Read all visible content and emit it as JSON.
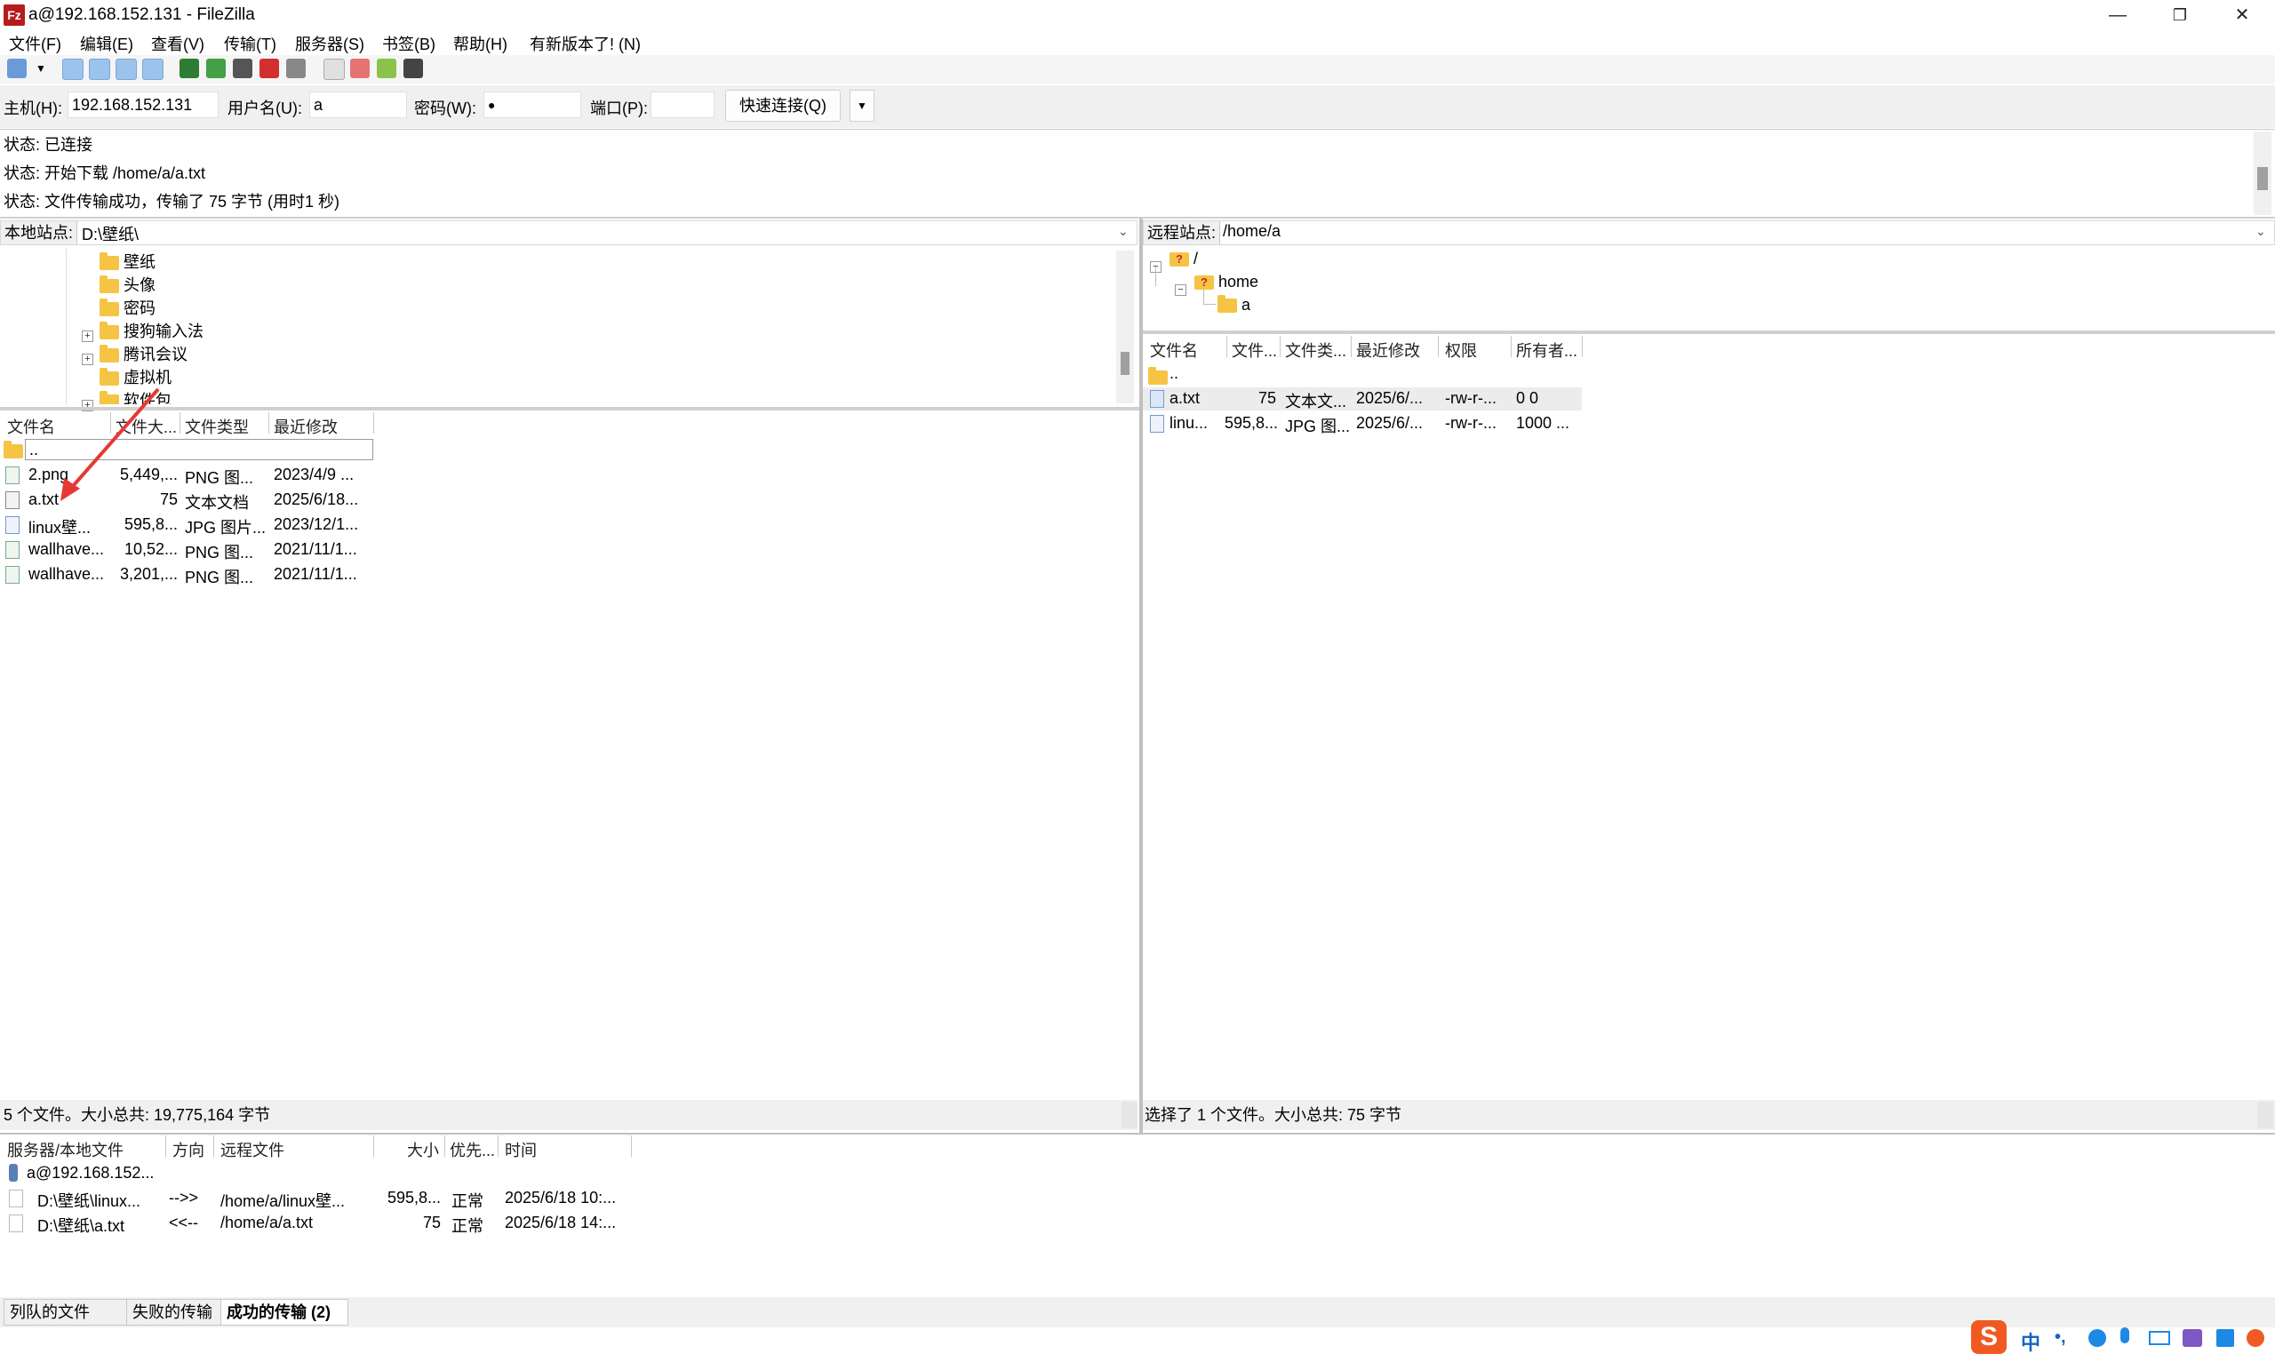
{
  "window": {
    "title": "a@192.168.152.131 - FileZilla",
    "app_icon": "Fz"
  },
  "menu": [
    "文件(F)",
    "编辑(E)",
    "查看(V)",
    "传输(T)",
    "服务器(S)",
    "书签(B)",
    "帮助(H)",
    "有新版本了! (N)"
  ],
  "quickconnect": {
    "host_label": "主机(H):",
    "host_value": "192.168.152.131",
    "user_label": "用户名(U):",
    "user_value": "a",
    "pass_label": "密码(W):",
    "pass_value": "●",
    "port_label": "端口(P):",
    "port_value": "",
    "button": "快速连接(Q)"
  },
  "log": [
    "状态: 已连接",
    "状态: 开始下载 /home/a/a.txt",
    "状态: 文件传输成功，传输了 75 字节 (用时1 秒)"
  ],
  "local": {
    "site_label": "本地站点:",
    "path": "D:\\壁纸\\",
    "tree": [
      "壁纸",
      "头像",
      "密码",
      "搜狗输入法",
      "腾讯会议",
      "虚拟机",
      "软件包"
    ],
    "headers": [
      "文件名",
      "文件大...",
      "文件类型",
      "最近修改"
    ],
    "parent": "..",
    "rows": [
      {
        "name": "2.png",
        "size": "5,449,...",
        "type": "PNG 图...",
        "modified": "2023/4/9 ..."
      },
      {
        "name": "a.txt",
        "size": "75",
        "type": "文本文档",
        "modified": "2025/6/18..."
      },
      {
        "name": "linux壁...",
        "size": "595,8...",
        "type": "JPG 图片...",
        "modified": "2023/12/1..."
      },
      {
        "name": "wallhave...",
        "size": "10,52...",
        "type": "PNG 图...",
        "modified": "2021/11/1..."
      },
      {
        "name": "wallhave...",
        "size": "3,201,...",
        "type": "PNG 图...",
        "modified": "2021/11/1..."
      }
    ],
    "status": "5 个文件。大小总共: 19,775,164 字节"
  },
  "remote": {
    "site_label": "远程站点:",
    "path": "/home/a",
    "tree": [
      "/",
      "home",
      "a"
    ],
    "headers": [
      "文件名",
      "文件...",
      "文件类...",
      "最近修改",
      "权限",
      "所有者..."
    ],
    "parent": "..",
    "rows": [
      {
        "name": "a.txt",
        "size": "75",
        "type": "文本文...",
        "modified": "2025/6/...",
        "perms": "-rw-r-...",
        "owner": "0 0"
      },
      {
        "name": "linu...",
        "size": "595,8...",
        "type": "JPG 图...",
        "modified": "2025/6/...",
        "perms": "-rw-r-...",
        "owner": "1000 ..."
      }
    ],
    "status": "选择了 1 个文件。大小总共: 75 字节"
  },
  "queue": {
    "headers": [
      "服务器/本地文件",
      "方向",
      "远程文件",
      "大小",
      "优先...",
      "时间"
    ],
    "server": "a@192.168.152...",
    "rows": [
      {
        "local": "D:\\壁纸\\linux...",
        "dir": "-->>",
        "remote": "/home/a/linux壁...",
        "size": "595,8...",
        "priority": "正常",
        "time": "2025/6/18 10:..."
      },
      {
        "local": "D:\\壁纸\\a.txt",
        "dir": "<<--",
        "remote": "/home/a/a.txt",
        "size": "75",
        "priority": "正常",
        "time": "2025/6/18 14:..."
      }
    ]
  },
  "tabs": [
    "列队的文件",
    "失败的传输",
    "成功的传输 (2)"
  ],
  "ime": {
    "lang": "中",
    "punct": "•,",
    "logo": "S"
  }
}
